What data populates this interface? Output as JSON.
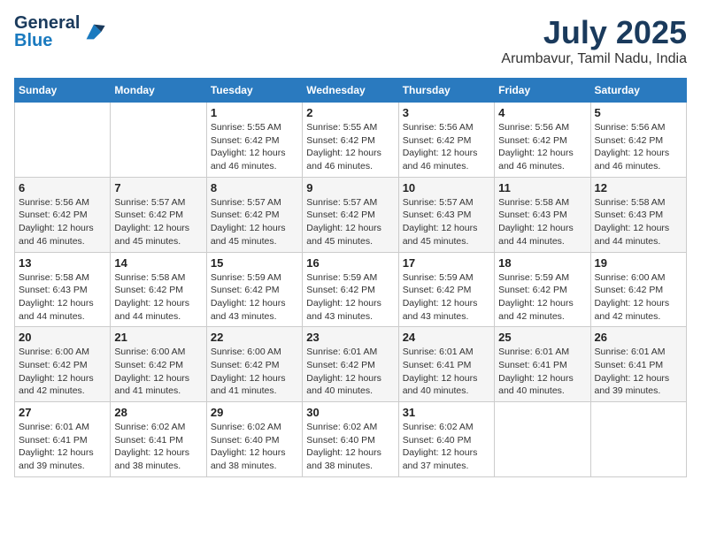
{
  "header": {
    "logo_line1": "General",
    "logo_line2": "Blue",
    "month_year": "July 2025",
    "location": "Arumbavur, Tamil Nadu, India"
  },
  "weekdays": [
    "Sunday",
    "Monday",
    "Tuesday",
    "Wednesday",
    "Thursday",
    "Friday",
    "Saturday"
  ],
  "weeks": [
    [
      {
        "day": "",
        "info": ""
      },
      {
        "day": "",
        "info": ""
      },
      {
        "day": "1",
        "info": "Sunrise: 5:55 AM\nSunset: 6:42 PM\nDaylight: 12 hours and 46 minutes."
      },
      {
        "day": "2",
        "info": "Sunrise: 5:55 AM\nSunset: 6:42 PM\nDaylight: 12 hours and 46 minutes."
      },
      {
        "day": "3",
        "info": "Sunrise: 5:56 AM\nSunset: 6:42 PM\nDaylight: 12 hours and 46 minutes."
      },
      {
        "day": "4",
        "info": "Sunrise: 5:56 AM\nSunset: 6:42 PM\nDaylight: 12 hours and 46 minutes."
      },
      {
        "day": "5",
        "info": "Sunrise: 5:56 AM\nSunset: 6:42 PM\nDaylight: 12 hours and 46 minutes."
      }
    ],
    [
      {
        "day": "6",
        "info": "Sunrise: 5:56 AM\nSunset: 6:42 PM\nDaylight: 12 hours and 46 minutes."
      },
      {
        "day": "7",
        "info": "Sunrise: 5:57 AM\nSunset: 6:42 PM\nDaylight: 12 hours and 45 minutes."
      },
      {
        "day": "8",
        "info": "Sunrise: 5:57 AM\nSunset: 6:42 PM\nDaylight: 12 hours and 45 minutes."
      },
      {
        "day": "9",
        "info": "Sunrise: 5:57 AM\nSunset: 6:42 PM\nDaylight: 12 hours and 45 minutes."
      },
      {
        "day": "10",
        "info": "Sunrise: 5:57 AM\nSunset: 6:43 PM\nDaylight: 12 hours and 45 minutes."
      },
      {
        "day": "11",
        "info": "Sunrise: 5:58 AM\nSunset: 6:43 PM\nDaylight: 12 hours and 44 minutes."
      },
      {
        "day": "12",
        "info": "Sunrise: 5:58 AM\nSunset: 6:43 PM\nDaylight: 12 hours and 44 minutes."
      }
    ],
    [
      {
        "day": "13",
        "info": "Sunrise: 5:58 AM\nSunset: 6:43 PM\nDaylight: 12 hours and 44 minutes."
      },
      {
        "day": "14",
        "info": "Sunrise: 5:58 AM\nSunset: 6:42 PM\nDaylight: 12 hours and 44 minutes."
      },
      {
        "day": "15",
        "info": "Sunrise: 5:59 AM\nSunset: 6:42 PM\nDaylight: 12 hours and 43 minutes."
      },
      {
        "day": "16",
        "info": "Sunrise: 5:59 AM\nSunset: 6:42 PM\nDaylight: 12 hours and 43 minutes."
      },
      {
        "day": "17",
        "info": "Sunrise: 5:59 AM\nSunset: 6:42 PM\nDaylight: 12 hours and 43 minutes."
      },
      {
        "day": "18",
        "info": "Sunrise: 5:59 AM\nSunset: 6:42 PM\nDaylight: 12 hours and 42 minutes."
      },
      {
        "day": "19",
        "info": "Sunrise: 6:00 AM\nSunset: 6:42 PM\nDaylight: 12 hours and 42 minutes."
      }
    ],
    [
      {
        "day": "20",
        "info": "Sunrise: 6:00 AM\nSunset: 6:42 PM\nDaylight: 12 hours and 42 minutes."
      },
      {
        "day": "21",
        "info": "Sunrise: 6:00 AM\nSunset: 6:42 PM\nDaylight: 12 hours and 41 minutes."
      },
      {
        "day": "22",
        "info": "Sunrise: 6:00 AM\nSunset: 6:42 PM\nDaylight: 12 hours and 41 minutes."
      },
      {
        "day": "23",
        "info": "Sunrise: 6:01 AM\nSunset: 6:42 PM\nDaylight: 12 hours and 40 minutes."
      },
      {
        "day": "24",
        "info": "Sunrise: 6:01 AM\nSunset: 6:41 PM\nDaylight: 12 hours and 40 minutes."
      },
      {
        "day": "25",
        "info": "Sunrise: 6:01 AM\nSunset: 6:41 PM\nDaylight: 12 hours and 40 minutes."
      },
      {
        "day": "26",
        "info": "Sunrise: 6:01 AM\nSunset: 6:41 PM\nDaylight: 12 hours and 39 minutes."
      }
    ],
    [
      {
        "day": "27",
        "info": "Sunrise: 6:01 AM\nSunset: 6:41 PM\nDaylight: 12 hours and 39 minutes."
      },
      {
        "day": "28",
        "info": "Sunrise: 6:02 AM\nSunset: 6:41 PM\nDaylight: 12 hours and 38 minutes."
      },
      {
        "day": "29",
        "info": "Sunrise: 6:02 AM\nSunset: 6:40 PM\nDaylight: 12 hours and 38 minutes."
      },
      {
        "day": "30",
        "info": "Sunrise: 6:02 AM\nSunset: 6:40 PM\nDaylight: 12 hours and 38 minutes."
      },
      {
        "day": "31",
        "info": "Sunrise: 6:02 AM\nSunset: 6:40 PM\nDaylight: 12 hours and 37 minutes."
      },
      {
        "day": "",
        "info": ""
      },
      {
        "day": "",
        "info": ""
      }
    ]
  ]
}
